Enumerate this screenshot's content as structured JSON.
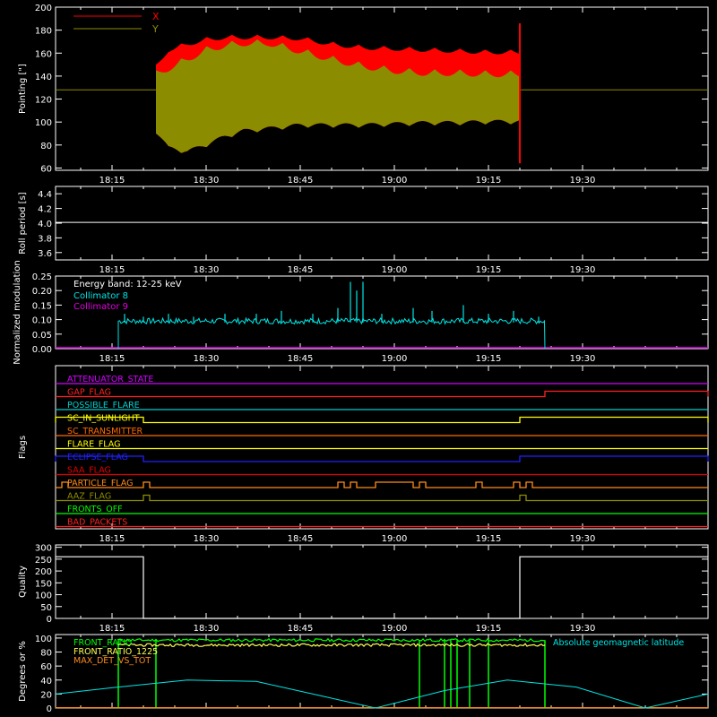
{
  "figure": {
    "background": "#000000",
    "foreground": "#ffffff",
    "time_ticks": [
      "18:15",
      "18:30",
      "18:45",
      "19:00",
      "19:15",
      "19:30"
    ]
  },
  "chart_data": [
    {
      "type": "area",
      "ylabel": "Pointing [\"]",
      "ylim": [
        58,
        200
      ],
      "yticks": [
        "60",
        "80",
        "100",
        "120",
        "140",
        "160",
        "180",
        "200"
      ],
      "legend": [
        {
          "name": "X",
          "color": "#ff0000"
        },
        {
          "name": "Y",
          "color": "#8c8c00"
        }
      ],
      "series": [
        {
          "name": "X",
          "color": "#ff0000",
          "x": [
            "18:22",
            "18:24",
            "18:27",
            "18:30",
            "18:33",
            "18:36",
            "18:40",
            "18:45",
            "18:50",
            "18:55",
            "19:00",
            "19:05",
            "19:10",
            "19:15",
            "19:20"
          ],
          "upper": [
            150,
            165,
            170,
            174,
            176,
            176,
            176,
            175,
            170,
            167,
            166,
            165,
            164,
            163,
            163
          ],
          "lower": [
            90,
            75,
            72,
            78,
            85,
            90,
            92,
            95,
            95,
            95,
            96,
            97,
            97,
            98,
            98
          ]
        },
        {
          "name": "Y",
          "color": "#8c8c00",
          "x": [
            "18:22",
            "18:24",
            "18:27",
            "18:30",
            "18:33",
            "18:36",
            "18:40",
            "18:45",
            "18:50",
            "18:55",
            "19:00",
            "19:05",
            "19:10",
            "19:15",
            "19:20"
          ],
          "upper": [
            145,
            150,
            158,
            166,
            170,
            172,
            172,
            165,
            158,
            152,
            148,
            146,
            146,
            145,
            145
          ],
          "lower": [
            90,
            75,
            72,
            78,
            85,
            90,
            92,
            95,
            95,
            95,
            96,
            97,
            97,
            98,
            98
          ]
        }
      ],
      "constant_line": {
        "value": 128,
        "color": "#8c8c00"
      }
    },
    {
      "type": "line",
      "ylabel": "Roll period [s]",
      "ylim": [
        3.5,
        4.5
      ],
      "yticks": [
        "3.6",
        "3.8",
        "4.0",
        "4.2",
        "4.4"
      ],
      "series": [
        {
          "name": "",
          "color": "#ffffff",
          "x": [
            "18:06",
            "19:50"
          ],
          "y": [
            4.01,
            4.01
          ]
        }
      ]
    },
    {
      "type": "line",
      "ylabel": "Normalized modulation",
      "ylim": [
        0,
        0.25
      ],
      "yticks": [
        "0.00",
        "0.05",
        "0.10",
        "0.15",
        "0.20",
        "0.25"
      ],
      "annotation": "Energy band: 12-25 keV",
      "legend": [
        {
          "name": "Collimator 8",
          "color": "#00e5e5"
        },
        {
          "name": "Collimator 9",
          "color": "#e000e0"
        }
      ],
      "series": [
        {
          "name": "Collimator 8",
          "color": "#00e5e5",
          "start": "18:16",
          "end": "19:24",
          "base": 0.09,
          "spikes": [
            {
              "x": "18:17",
              "y": 0.12
            },
            {
              "x": "18:20",
              "y": 0.11
            },
            {
              "x": "18:24",
              "y": 0.12
            },
            {
              "x": "18:28",
              "y": 0.11
            },
            {
              "x": "18:33",
              "y": 0.12
            },
            {
              "x": "18:38",
              "y": 0.12
            },
            {
              "x": "18:42",
              "y": 0.13
            },
            {
              "x": "18:47",
              "y": 0.12
            },
            {
              "x": "18:51",
              "y": 0.14
            },
            {
              "x": "18:53",
              "y": 0.23
            },
            {
              "x": "18:54",
              "y": 0.2
            },
            {
              "x": "18:55",
              "y": 0.23
            },
            {
              "x": "18:58",
              "y": 0.12
            },
            {
              "x": "19:03",
              "y": 0.14
            },
            {
              "x": "19:06",
              "y": 0.13
            },
            {
              "x": "19:11",
              "y": 0.15
            },
            {
              "x": "19:15",
              "y": 0.12
            },
            {
              "x": "19:19",
              "y": 0.13
            },
            {
              "x": "19:23",
              "y": 0.11
            }
          ]
        },
        {
          "name": "Collimator 9",
          "color": "#e000e0",
          "start": "18:06",
          "end": "19:50",
          "base": 0.0
        }
      ]
    },
    {
      "type": "table",
      "ylabel": "Flags",
      "flags": [
        {
          "name": "ATTENUATOR_STATE",
          "color": "#d400ff",
          "steps": []
        },
        {
          "name": "GAP_FLAG",
          "color": "#ff2020",
          "steps": [
            {
              "from": "19:24",
              "to": "19:50"
            }
          ]
        },
        {
          "name": "POSSIBLE_FLARE",
          "color": "#00d0d0",
          "steps": []
        },
        {
          "name": "SC_IN_SUNLIGHT",
          "color": "#ffff00",
          "steps": [
            {
              "from": "18:06",
              "to": "18:20"
            },
            {
              "from": "19:20",
              "to": "19:50"
            }
          ]
        },
        {
          "name": "SC_TRANSMITTER",
          "color": "#ff6a00",
          "steps": []
        },
        {
          "name": "FLARE_FLAG",
          "color": "#ffff00",
          "steps": []
        },
        {
          "name": "ECLIPSE_FLAG",
          "color": "#2020ff",
          "steps": [
            {
              "from": "18:06",
              "to": "18:20"
            },
            {
              "from": "19:20",
              "to": "19:50"
            }
          ]
        },
        {
          "name": "SAA_FLAG",
          "color": "#e00000",
          "steps": []
        },
        {
          "name": "PARTICLE_FLAG",
          "color": "#ff8c1a",
          "steps": [
            {
              "from": "18:07",
              "to": "18:08"
            },
            {
              "from": "18:20",
              "to": "18:21"
            },
            {
              "from": "18:51",
              "to": "18:52"
            },
            {
              "from": "18:53",
              "to": "18:54"
            },
            {
              "from": "18:57",
              "to": "19:03"
            },
            {
              "from": "19:04",
              "to": "19:05"
            },
            {
              "from": "19:13",
              "to": "19:14"
            },
            {
              "from": "19:19",
              "to": "19:20"
            },
            {
              "from": "19:21",
              "to": "19:22"
            }
          ]
        },
        {
          "name": "AAZ_FLAG",
          "color": "#8c8c00",
          "steps": [
            {
              "from": "18:20",
              "to": "18:21"
            },
            {
              "from": "19:20",
              "to": "19:21"
            }
          ]
        },
        {
          "name": "FRONTS_OFF",
          "color": "#00ff00",
          "steps": []
        },
        {
          "name": "BAD_PACKETS",
          "color": "#ff2020",
          "steps": []
        }
      ]
    },
    {
      "type": "line",
      "ylabel": "Quality",
      "ylim": [
        0,
        310
      ],
      "yticks": [
        "0",
        "50",
        "100",
        "150",
        "200",
        "250",
        "300"
      ],
      "series": [
        {
          "name": "",
          "color": "#ffffff",
          "x": [
            "18:06",
            "18:20",
            "18:20",
            "19:20",
            "19:20",
            "19:50"
          ],
          "y": [
            260,
            260,
            0,
            0,
            260,
            260
          ]
        }
      ]
    },
    {
      "type": "line",
      "ylabel": "Degrees or %",
      "ylim": [
        0,
        105
      ],
      "yticks": [
        "0",
        "20",
        "40",
        "60",
        "80",
        "100"
      ],
      "legend": [
        {
          "name": "FRONT_RATIO",
          "color": "#00ff00"
        },
        {
          "name": "FRONT_RATIO_1225",
          "color": "#ffff55"
        },
        {
          "name": "MAX_DET_VS_TOT",
          "color": "#ff8c1a"
        },
        {
          "name": "Absolute geomagnetic latitude",
          "color": "#00e5e5"
        }
      ],
      "series": [
        {
          "name": "FRONT_RATIO",
          "color": "#00ff00",
          "start": "18:16",
          "end": "19:24",
          "base": 97,
          "dropouts": [
            "18:16",
            "18:22",
            "19:04",
            "19:08",
            "19:09",
            "19:10",
            "19:12",
            "19:15",
            "19:24"
          ]
        },
        {
          "name": "FRONT_RATIO_1225",
          "color": "#ffff55",
          "start": "18:16",
          "end": "19:24",
          "base": 90,
          "dropouts": []
        },
        {
          "name": "MAX_DET_VS_TOT",
          "color": "#ff8c1a",
          "start": "18:06",
          "end": "19:50",
          "base": 0,
          "dropouts": []
        },
        {
          "name": "Absolute geomagnetic latitude",
          "color": "#00e5e5",
          "x": [
            "18:06",
            "18:16",
            "18:27",
            "18:38",
            "18:48",
            "18:57",
            "19:08",
            "19:18",
            "19:29",
            "19:40",
            "19:50"
          ],
          "y": [
            20,
            30,
            40,
            38,
            18,
            0,
            25,
            40,
            30,
            0,
            20
          ]
        }
      ]
    }
  ]
}
